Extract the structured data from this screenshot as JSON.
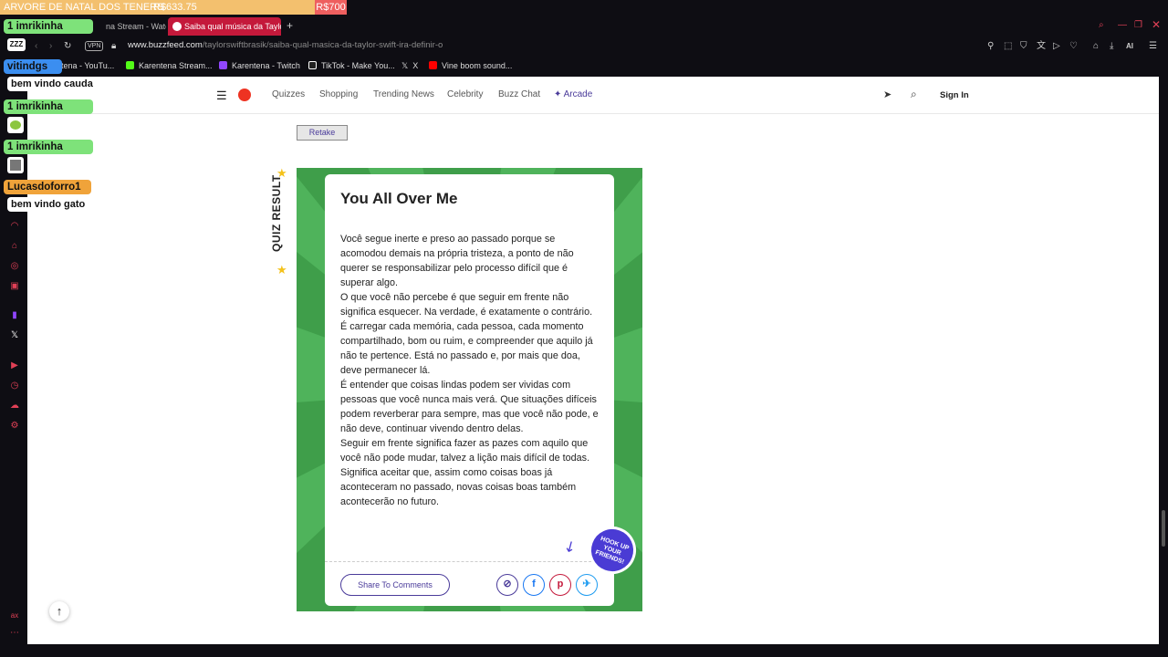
{
  "donation": {
    "title": "ARVORE DE NATAL DOS TENERS",
    "current": "R$633.75",
    "goal": "R$700"
  },
  "tabs": [
    {
      "label": "na Stream - Watch",
      "active": false
    },
    {
      "label": "Saiba qual música da Taylo",
      "active": true
    }
  ],
  "browser": {
    "url_host": "www.buzzfeed.com",
    "url_path": "/taylorswiftbrasik/saiba-qual-masica-da-taylor-swift-ira-definir-o",
    "vpn_label": "VPN",
    "ai_label": "AI"
  },
  "bookmarks": [
    "ntena - YouTu...",
    "Karentena Stream...",
    "Karentena - Twitch",
    "TikTok - Make You...",
    "X",
    "Vine boom sound..."
  ],
  "site_nav": {
    "links": [
      "Quizzes",
      "Shopping",
      "Trending News",
      "Celebrity",
      "Buzz Chat",
      "Arcade"
    ],
    "sign_in": "Sign In"
  },
  "quiz": {
    "retake": "Retake",
    "label": "QUIZ RESULT",
    "result_title": "You All Over Me",
    "paragraphs": [
      "Você segue inerte e preso ao passado porque se acomodou demais na própria tristeza, a ponto de não querer se responsabilizar pelo processo difícil que é superar algo.",
      "O que você não percebe é que seguir em frente não significa esquecer. Na verdade, é exatamente o contrário.",
      "É carregar cada memória, cada pessoa, cada momento compartilhado, bom ou ruim, e compreender que aquilo já não te pertence. Está no passado e, por mais que doa, deve permanecer lá.",
      "É entender que coisas lindas podem ser vividas com pessoas que você nunca mais verá. Que situações difíceis podem reverberar para sempre, mas que você não pode, e não deve, continuar vivendo dentro delas.",
      "Seguir em frente significa fazer as pazes com aquilo que você não pode mudar, talvez a lição mais difícil de todas. Significa aceitar que, assim como coisas boas já aconteceram no passado, novas coisas boas também acontecerão no futuro."
    ],
    "share_comments": "Share To Comments",
    "hookup_badge": "HOOK UP YOUR FRIENDS!"
  },
  "chat": [
    {
      "user": "imrikinha",
      "badge": "1",
      "color": "#7ee27a",
      "message": ""
    },
    {
      "user": "vitindgs",
      "badge": "",
      "color": "#3b8ef0",
      "message": "bem vindo cauda"
    },
    {
      "user": "imrikinha",
      "badge": "1",
      "color": "#7ee27a",
      "message": ""
    },
    {
      "user": "imrikinha",
      "badge": "1",
      "color": "#7ee27a",
      "message": ""
    },
    {
      "user": "Lucasdoforro1",
      "badge": "",
      "color": "#f0a33a",
      "message": "bem vindo gato"
    }
  ],
  "colors": {
    "accent": "#4a3b9a",
    "quiz_green": "#4fb35b",
    "tab_active": "#c4193b",
    "pinterest": "#c4193b",
    "facebook": "#1877f2",
    "bluesky": "#1d9bf0"
  }
}
